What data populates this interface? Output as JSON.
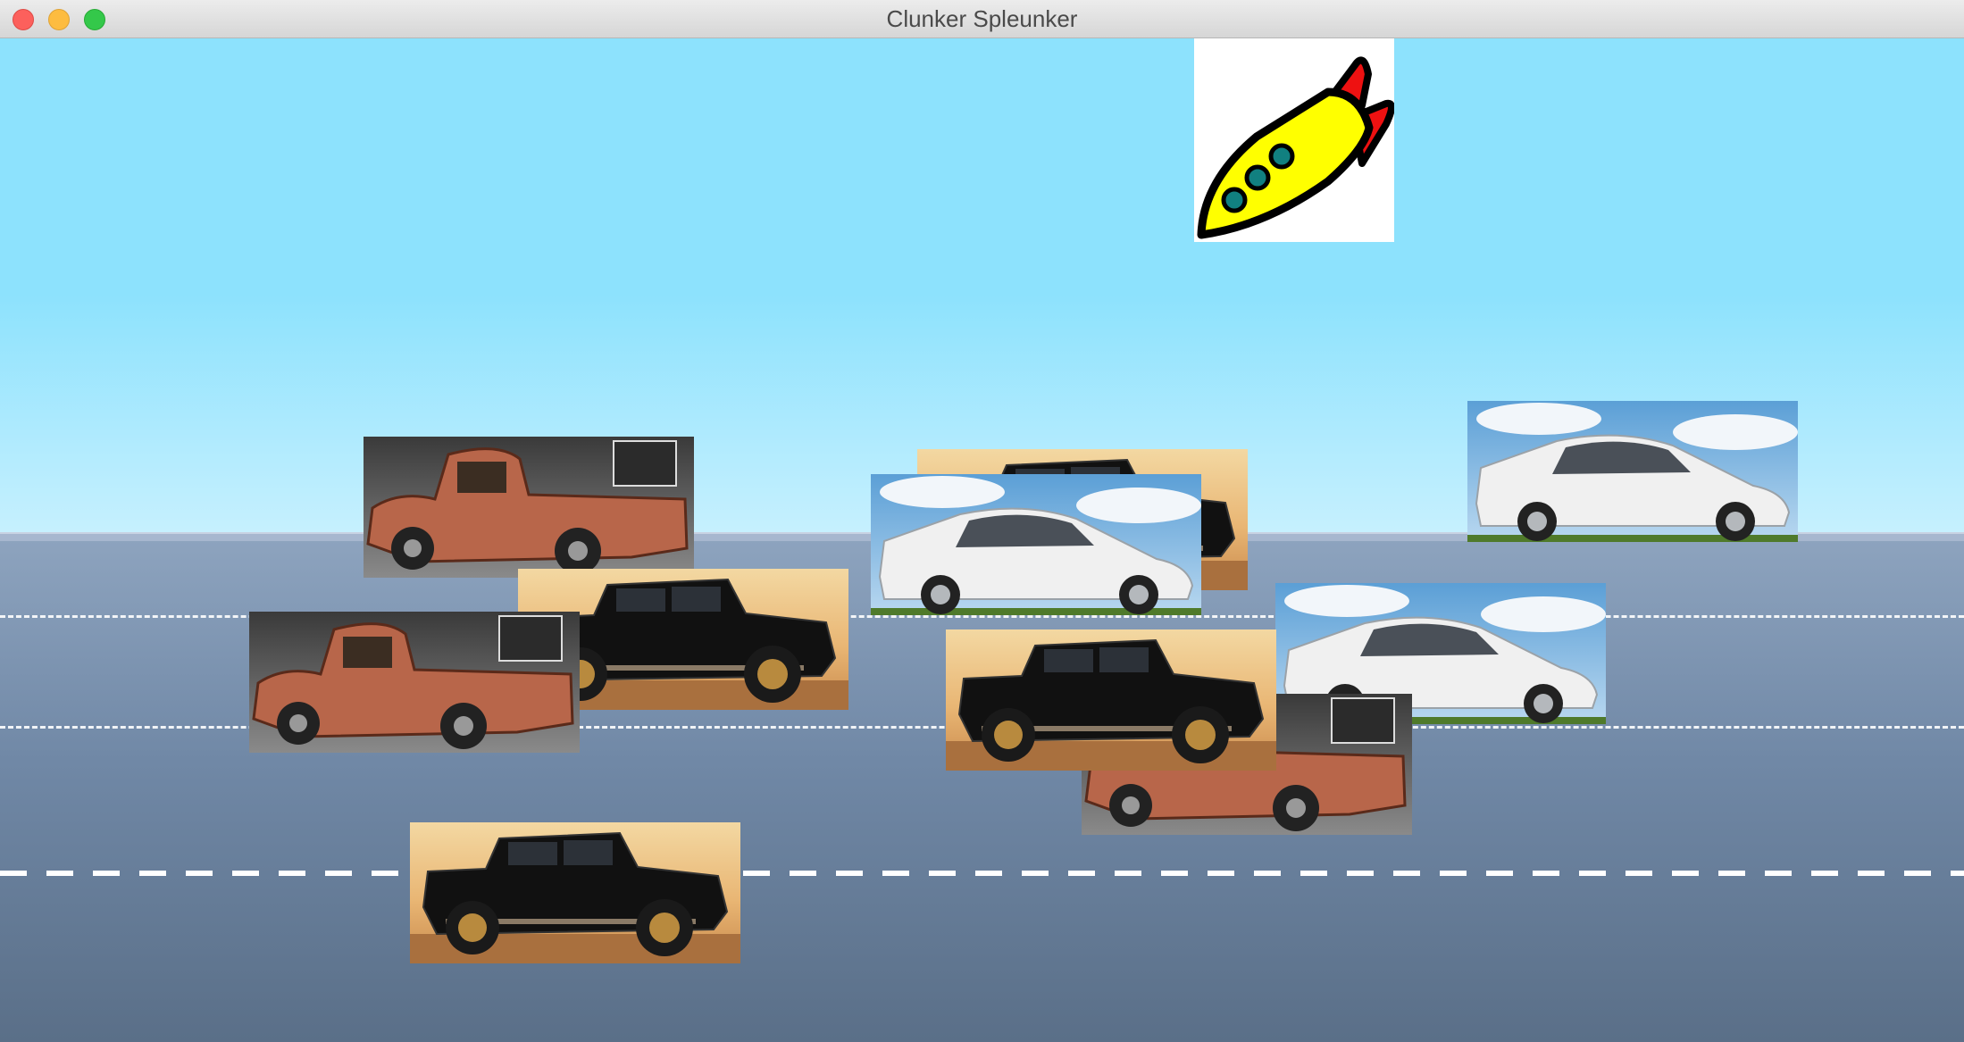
{
  "window": {
    "title": "Clunker Spleunker",
    "controls": {
      "close": "close-button",
      "minimize": "minimize-button",
      "zoom": "zoom-button"
    }
  },
  "scene": {
    "sky_color": "#8de2fd",
    "road_color": "#7088a6",
    "lane_marking_color": "#ffffff",
    "player": {
      "sprite": "rocket-icon",
      "body_color": "#ffff00",
      "fin_color": "#ee1111",
      "window_color": "#118080"
    },
    "vehicles": [
      {
        "type": "rusty-pickup",
        "lane": 1
      },
      {
        "type": "black-hummer",
        "lane": 1
      },
      {
        "type": "white-prius",
        "lane": 1
      },
      {
        "type": "white-prius",
        "lane": 1
      },
      {
        "type": "rusty-pickup",
        "lane": 2
      },
      {
        "type": "black-hummer",
        "lane": 2
      },
      {
        "type": "rusty-pickup",
        "lane": 2
      },
      {
        "type": "black-hummer",
        "lane": 3
      },
      {
        "type": "white-prius",
        "lane": 2
      },
      {
        "type": "black-hummer",
        "lane": 3
      },
      {
        "type": "rusty-pickup",
        "lane": 3
      },
      {
        "type": "black-hummer",
        "lane": 4
      }
    ]
  }
}
